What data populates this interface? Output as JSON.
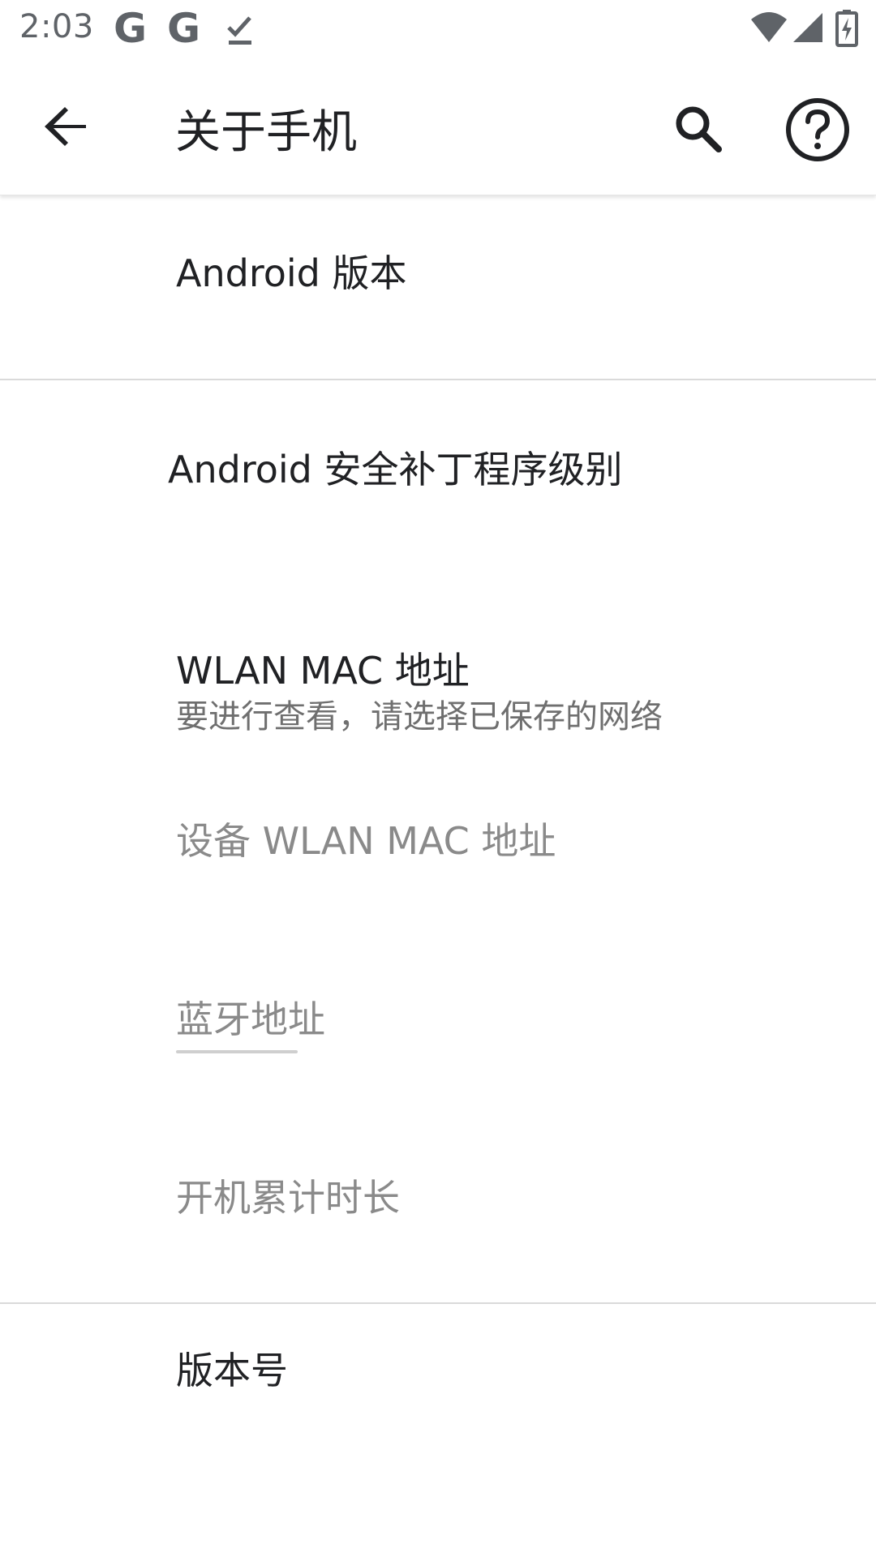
{
  "status_bar": {
    "time": "2:03",
    "google_icon_1": "G",
    "google_icon_2": "G",
    "icons": [
      "google-icon",
      "google-icon",
      "download-done-icon",
      "wifi-icon",
      "cell-signal-icon",
      "battery-charging-icon"
    ]
  },
  "app_bar": {
    "title": "关于手机",
    "icons": [
      "back-arrow-icon",
      "search-icon",
      "help-icon"
    ]
  },
  "items": [
    {
      "title": "Android 版本",
      "summary": "",
      "enabled": true
    },
    {
      "title": "Android 安全补丁程序级别",
      "summary": "",
      "enabled": true
    },
    {
      "title": "WLAN MAC 地址",
      "summary": "要进行查看，请选择已保存的网络",
      "enabled": true
    },
    {
      "title": "设备 WLAN MAC 地址",
      "summary": "",
      "enabled": false
    },
    {
      "title": "蓝牙地址",
      "summary": "",
      "enabled": false
    },
    {
      "title": "开机累计时长",
      "summary": "",
      "enabled": false
    },
    {
      "title": "版本号",
      "summary": "",
      "enabled": true
    }
  ],
  "colors": {
    "text_primary": "#202124",
    "text_disabled": "#8a8a8a",
    "text_secondary": "#6f6f6f",
    "icon": "#5f6368",
    "divider": "#dadada",
    "background": "#ffffff"
  }
}
